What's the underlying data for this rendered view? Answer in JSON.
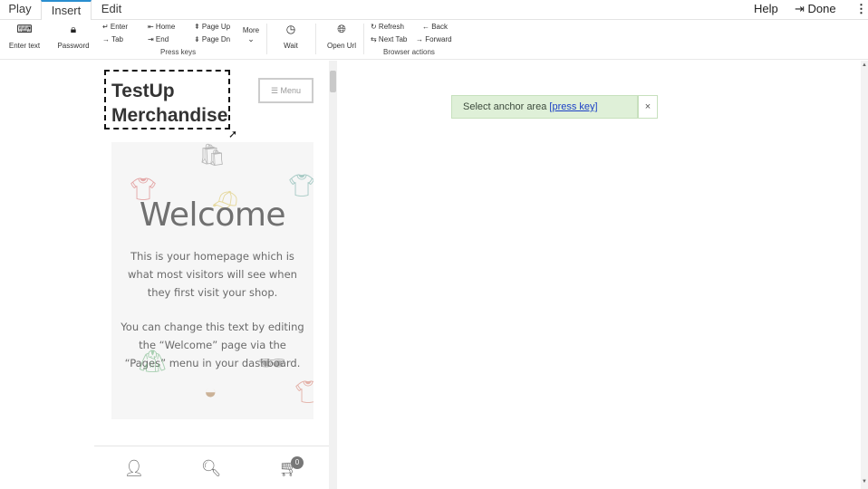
{
  "tabs": [
    {
      "label": "Play"
    },
    {
      "label": "Insert"
    },
    {
      "label": "Edit"
    }
  ],
  "top_right": {
    "help": "Help",
    "done": "Done",
    "menu_icon": "⋮"
  },
  "toolbar": {
    "enter_text": "Enter text",
    "password": "Password",
    "keys": {
      "enter": "↵ Enter",
      "tab": "→ Tab",
      "home": "⇤ Home",
      "end": "⇥ End",
      "page_up": "⇞ Page Up",
      "page_dn": "⇟ Page Dn",
      "more": "More"
    },
    "press_keys_label": "Press keys",
    "wait": "Wait",
    "open_url": "Open Url",
    "browser": {
      "refresh": "↻ Refresh",
      "back": "← Back",
      "next_tab": "⇆ Next Tab",
      "forward": "→ Forward"
    },
    "browser_actions_label": "Browser actions"
  },
  "preview": {
    "site_title": "TestUp Merchandise",
    "menu_label": "Menu",
    "welcome": "Welcome",
    "paragraph1": "This is your homepage which is what most visitors will see when they first visit your shop.",
    "paragraph2": "You can change this text by editing the “Welcome” page via the “Pages” menu in your dashboard.",
    "cart_count": "0"
  },
  "toast": {
    "text": "Select anchor area ",
    "link": "[press key]",
    "close": "×"
  },
  "icons": [
    "keyboard-icon",
    "lock-icon",
    "clock-icon",
    "globe-icon",
    "user-icon",
    "search-icon",
    "cart-icon",
    "signout-icon",
    "kebab-icon"
  ]
}
